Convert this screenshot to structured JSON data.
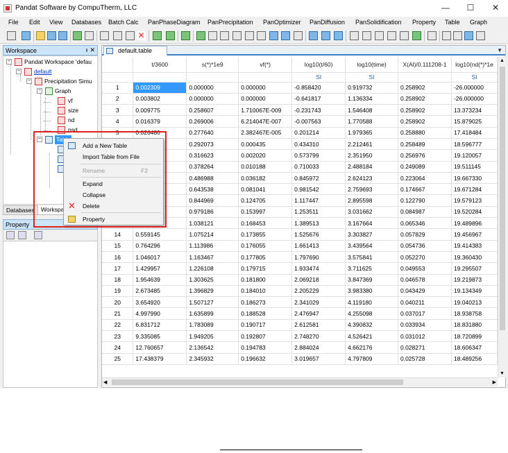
{
  "window": {
    "title": "Pandat Software by CompuTherm, LLC",
    "min": "—",
    "max": "☐",
    "close": "✕"
  },
  "menu": [
    "File",
    "Edit",
    "View",
    "Databases",
    "Batch Calc",
    "PanPhaseDiagram",
    "PanPrecipitation",
    "PanOptimizer",
    "PanDiffusion",
    "PanSolidification",
    "Property",
    "Table",
    "Graph"
  ],
  "workspace": {
    "title": "Workspace",
    "pin": "ᵼ",
    "close": "✕",
    "tree": {
      "root": "Pandat Workspace 'defau",
      "default": "default",
      "precip": "Precipitation Simu",
      "graph": "Graph",
      "vf": "vf",
      "size": "size",
      "nd": "nd",
      "psd": "psd",
      "table": "Table"
    }
  },
  "bottom_tabs": [
    "Databases",
    "Workspace"
  ],
  "property_panel": {
    "title": "Property"
  },
  "document": {
    "tab_label": "default.table",
    "columns": [
      "t/3600",
      "s(*)*1e9",
      "vf(*)",
      "log10(t/60)",
      "log10(time)",
      "X(Al)/0.111208-1",
      "log10(nd(*)*1e"
    ],
    "units": [
      "",
      "",
      "",
      "SI",
      "SI",
      "",
      "SI"
    ],
    "rows": [
      [
        "1",
        "0.002309",
        "0.000000",
        "0.000000",
        "-0.858420",
        "0.919732",
        "0.258902",
        "-26.000000"
      ],
      [
        "2",
        "0.003802",
        "0.000000",
        "0.000000",
        "-0.641817",
        "1.136334",
        "0.258902",
        "-26.000000"
      ],
      [
        "3",
        "0.009775",
        "0.258607",
        "1.710067E-009",
        "-0.231743",
        "1.546408",
        "0.258902",
        "13.373234"
      ],
      [
        "4",
        "0.016379",
        "0.269006",
        "6.214047E-007",
        "-0.007563",
        "1.770588",
        "0.258902",
        "15.879025"
      ],
      [
        "5",
        "0.026480",
        "0.277640",
        "2.382467E-005",
        "0.201214",
        "1.979365",
        "0.258880",
        "17.418484"
      ],
      [
        "6",
        "",
        "0.292073",
        "0.000435",
        "0.434310",
        "2.212461",
        "0.258489",
        "18.596777"
      ],
      [
        "7",
        "",
        "0.316623",
        "0.002020",
        "0.573799",
        "2.351950",
        "0.256976",
        "19.120057"
      ],
      [
        "8",
        "",
        "0.378264",
        "0.010188",
        "0.710033",
        "2.488184",
        "0.249089",
        "19.511145"
      ],
      [
        "9",
        "",
        "0.486988",
        "0.036182",
        "0.845972",
        "2.624123",
        "0.223064",
        "19.667330"
      ],
      [
        "10",
        "",
        "0.643538",
        "0.081041",
        "0.981542",
        "2.759693",
        "0.174667",
        "19.671284"
      ],
      [
        "11",
        "",
        "0.844969",
        "0.124705",
        "1.117447",
        "2.895598",
        "0.122790",
        "19.579123"
      ],
      [
        "12",
        "",
        "0.979186",
        "0.153997",
        "1.253511",
        "3.031662",
        "0.084987",
        "19.520284"
      ],
      [
        "13",
        "0.408659",
        "1.038121",
        "0.168453",
        "1.389513",
        "3.167664",
        "0.065346",
        "19.489896"
      ],
      [
        "14",
        "0.559145",
        "1.075214",
        "0.173855",
        "1.525676",
        "3.303827",
        "0.057829",
        "19.456967"
      ],
      [
        "15",
        "0.764296",
        "1.113986",
        "0.176055",
        "1.661413",
        "3.439564",
        "0.054736",
        "19.414383"
      ],
      [
        "16",
        "1.046017",
        "1.163467",
        "0.177805",
        "1.797690",
        "3.575841",
        "0.052270",
        "19.360430"
      ],
      [
        "17",
        "1.429957",
        "1.226108",
        "0.179715",
        "1.933474",
        "3.711625",
        "0.049553",
        "19.295507"
      ],
      [
        "18",
        "1.954639",
        "1.303625",
        "0.181800",
        "2.069218",
        "3.847369",
        "0.046578",
        "19.219873"
      ],
      [
        "19",
        "2.673485",
        "1.396829",
        "0.184010",
        "2.205229",
        "3.983380",
        "0.043429",
        "19.134349"
      ],
      [
        "20",
        "3.654920",
        "1.507127",
        "0.186273",
        "2.341029",
        "4.119180",
        "0.040211",
        "19.040213"
      ],
      [
        "21",
        "4.997990",
        "1.635899",
        "0.188528",
        "2.476947",
        "4.255098",
        "0.037017",
        "18.938758"
      ],
      [
        "22",
        "6.831712",
        "1.783089",
        "0.190717",
        "2.612581",
        "4.390832",
        "0.033934",
        "18.831880"
      ],
      [
        "23",
        "9.335085",
        "1.949205",
        "0.192807",
        "2.748270",
        "4.526421",
        "0.031012",
        "18.720899"
      ],
      [
        "24",
        "12.760657",
        "2.136542",
        "0.194783",
        "2.884024",
        "4.662176",
        "0.028271",
        "18.606347"
      ],
      [
        "25",
        "17.438379",
        "2.345932",
        "0.196632",
        "3.019657",
        "4.797809",
        "0.025728",
        "18.489256"
      ]
    ]
  },
  "context_menu": {
    "add_table": "Add a New Table",
    "import_table": "Import Table from File",
    "rename": "Rename",
    "rename_shortcut": "F2",
    "expand": "Expand",
    "collapse": "Collapse",
    "delete": "Delete",
    "property": "Property"
  },
  "colors": {
    "selection": "#3399ff",
    "highlight_box": "#e0201b",
    "unit_text": "#2f5d9c"
  }
}
